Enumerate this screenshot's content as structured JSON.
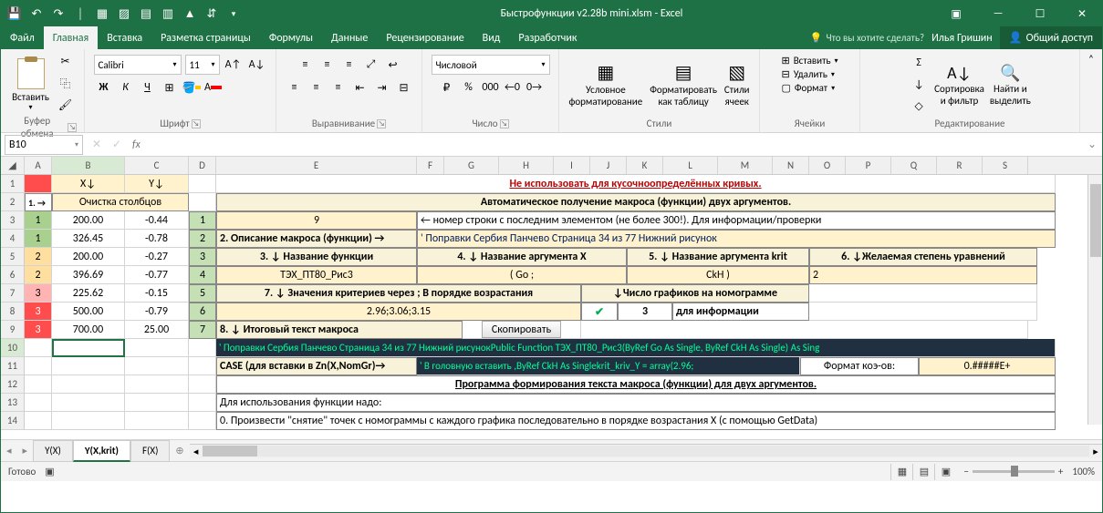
{
  "title": "Быстрофункции v2.28b mini.xlsm - Excel",
  "user": "Илья Гришин",
  "share": "Общий доступ",
  "tell_me": "Что вы хотите сделать?",
  "tabs": {
    "file": "Файл",
    "home": "Главная",
    "insert": "Вставка",
    "layout": "Разметка страницы",
    "formulas": "Формулы",
    "data": "Данные",
    "review": "Рецензирование",
    "view": "Вид",
    "dev": "Разработчик"
  },
  "ribbon": {
    "paste": "Вставить",
    "clipboard": "Буфер обмена",
    "font_name": "Calibri",
    "font_size": "11",
    "font": "Шрифт",
    "align": "Выравнивание",
    "num_format": "Числовой",
    "number": "Число",
    "cond_fmt": "Условное\nформатирование",
    "fmt_table": "Форматировать\nкак таблицу",
    "cell_styles": "Стили\nячеек",
    "styles": "Стили",
    "insert": "Вставить",
    "delete": "Удалить",
    "format": "Формат",
    "cells": "Ячейки",
    "sort": "Сортировка\nи фильтр",
    "find": "Найти и\nвыделить",
    "editing": "Редактирование"
  },
  "namebox": "B10",
  "cols_left": [
    "A",
    "B",
    "C"
  ],
  "cols_right": [
    "D",
    "E",
    "F",
    "G",
    "H",
    "I",
    "J",
    "K",
    "L",
    "M",
    "N",
    "O",
    "P",
    "Q",
    "R",
    "S"
  ],
  "left": {
    "h1": "X↓",
    "h2": "Y↓",
    "clean": "Очистка столбцов",
    "arrow": "1.  →",
    "rows": [
      {
        "c": "1",
        "x": "200.00",
        "y": "-0.44"
      },
      {
        "c": "1",
        "x": "326.45",
        "y": "-0.78"
      },
      {
        "c": "2",
        "x": "200.00",
        "y": "-0.27"
      },
      {
        "c": "2",
        "x": "396.69",
        "y": "-0.77"
      },
      {
        "c": "3",
        "x": "225.62",
        "y": "-0.15"
      },
      {
        "c": "3",
        "x": "500.00",
        "y": "-0.79"
      },
      {
        "c": "3",
        "x": "700.00",
        "y": "25.00"
      }
    ]
  },
  "right": {
    "warn": "Не использовать для кусочноопределённых кривых.",
    "auto": "Автоматическое получение макроса (функции) двух аргументов.",
    "r1": {
      "n": "1",
      "v": "9",
      "t": "← номер строки с последним элементом (не более 300!). Для информации/проверки"
    },
    "r2": {
      "n": "2",
      "l": "2. Описание макроса (функции) →",
      "v": "' Поправки Сербия Панчево Страница 34 из 77 Нижний рисунок"
    },
    "r3": {
      "n": "3",
      "c1": "3. ↓ Название функции",
      "c2": "4. ↓ Название аргумента X",
      "c3": "5. ↓ Название аргумента krit",
      "c4": "6. ↓Желаемая степень уравнений"
    },
    "r4": {
      "n": "4",
      "c1": "ТЭХ_ПТ80_Рис3",
      "c2": "(                         Go                          ;",
      "c3": "CkH                        )",
      "c4": "2"
    },
    "r5": {
      "n": "5",
      "l": "7. ↓ Значения критериев через ; В порядке возрастания",
      "r": "↓Число графиков на номограмме"
    },
    "r6": {
      "n": "6",
      "v": "2.96;3.06;3.15",
      "c": "✔",
      "n2": "3",
      "t": "для информации"
    },
    "r7": {
      "n": "7",
      "l": "8. ↓ Итоговый текст макроса",
      "btn": "Скопировать"
    },
    "r8": "' Поправки Сербия Панчево Страница 34 из 77 Нижний рисунокPublic Function ТЭХ_ПТ80_Рис3(ByRef Go As Single, ByRef CkH As Single) As Sing",
    "r9": {
      "l": "CASE (для вставки в Zn(X,NomGr)→",
      "v": "' В головную вставить ,ByRef CkH As Singlekrit_kriv_Y = array(2.96;",
      "f": "Формат коэ-ов:",
      "fv": "0.#####E+"
    },
    "r10": "Программа формирования текста макроса (функции) для двух аргументов.",
    "r11": "Для использования функции надо:",
    "r12": "0. Произвести \"снятие\" точек с номограммы с каждого графика последовательно в порядке возрастания X (с помощью GetData)"
  },
  "sheets": {
    "s1": "Y(X)",
    "s2": "Y(X,krit)",
    "s3": "F(X)"
  },
  "status": "Готово",
  "zoom": "100%",
  "zoom_btns": {
    "minus": "−",
    "plus": "+"
  }
}
